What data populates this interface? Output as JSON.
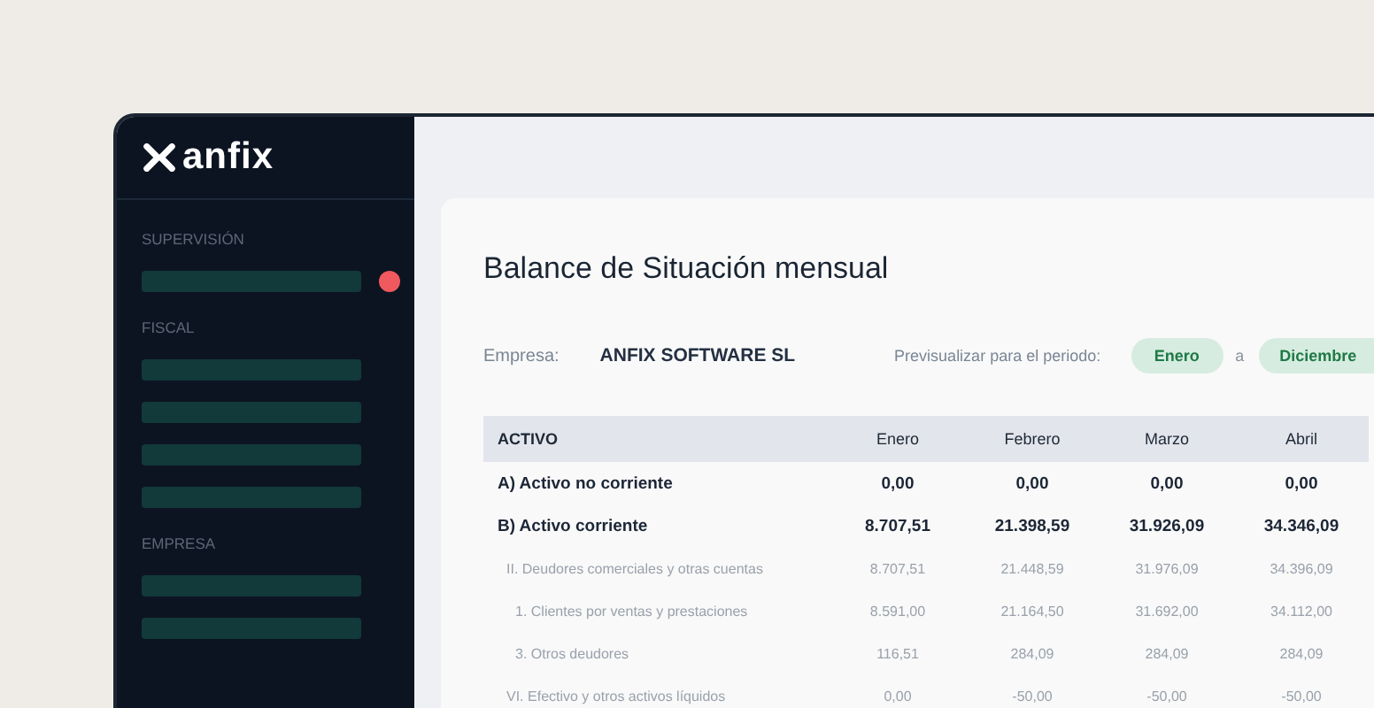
{
  "sidebar": {
    "logo": "anfix",
    "sections": [
      {
        "title": "SUPERVISIÓN",
        "items": [
          {
            "notification": true
          }
        ]
      },
      {
        "title": "FISCAL",
        "items": [
          {
            "notification": false
          },
          {
            "notification": false
          },
          {
            "notification": false
          },
          {
            "notification": false
          }
        ]
      },
      {
        "title": "EMPRESA",
        "items": [
          {
            "notification": false
          },
          {
            "notification": false
          }
        ]
      }
    ]
  },
  "report": {
    "title": "Balance de Situación mensual",
    "company_label": "Empresa:",
    "company": "ANFIX SOFTWARE SL",
    "period_label": "Previsualizar para el periodo:",
    "period_from": "Enero",
    "period_separator": "a",
    "period_to": "Diciembre",
    "table": {
      "columns": [
        "ACTIVO",
        "Enero",
        "Febrero",
        "Marzo",
        "Abril"
      ],
      "rows": [
        {
          "kind": "total",
          "label": "A) Activo no corriente",
          "values": [
            "0,00",
            "0,00",
            "0,00",
            "0,00"
          ]
        },
        {
          "kind": "total",
          "label": "B) Activo corriente",
          "values": [
            "8.707,51",
            "21.398,59",
            "31.926,09",
            "34.346,09"
          ],
          "children": [
            {
              "kind": "detail",
              "label": "II. Deudores comerciales y otras cuentas",
              "values": [
                "8.707,51",
                "21.448,59",
                "31.976,09",
                "34.396,09"
              ],
              "children": [
                {
                  "kind": "detail",
                  "label": "1. Clientes por ventas y prestaciones",
                  "values": [
                    "8.591,00",
                    "21.164,50",
                    "31.692,00",
                    "34.112,00"
                  ]
                },
                {
                  "kind": "detail",
                  "label": "3. Otros deudores",
                  "values": [
                    "116,51",
                    "284,09",
                    "284,09",
                    "284,09"
                  ]
                }
              ]
            },
            {
              "kind": "detail",
              "label": "VI. Efectivo y otros activos líquidos",
              "values": [
                "0,00",
                "-50,00",
                "-50,00",
                "-50,00"
              ]
            }
          ]
        }
      ]
    }
  }
}
